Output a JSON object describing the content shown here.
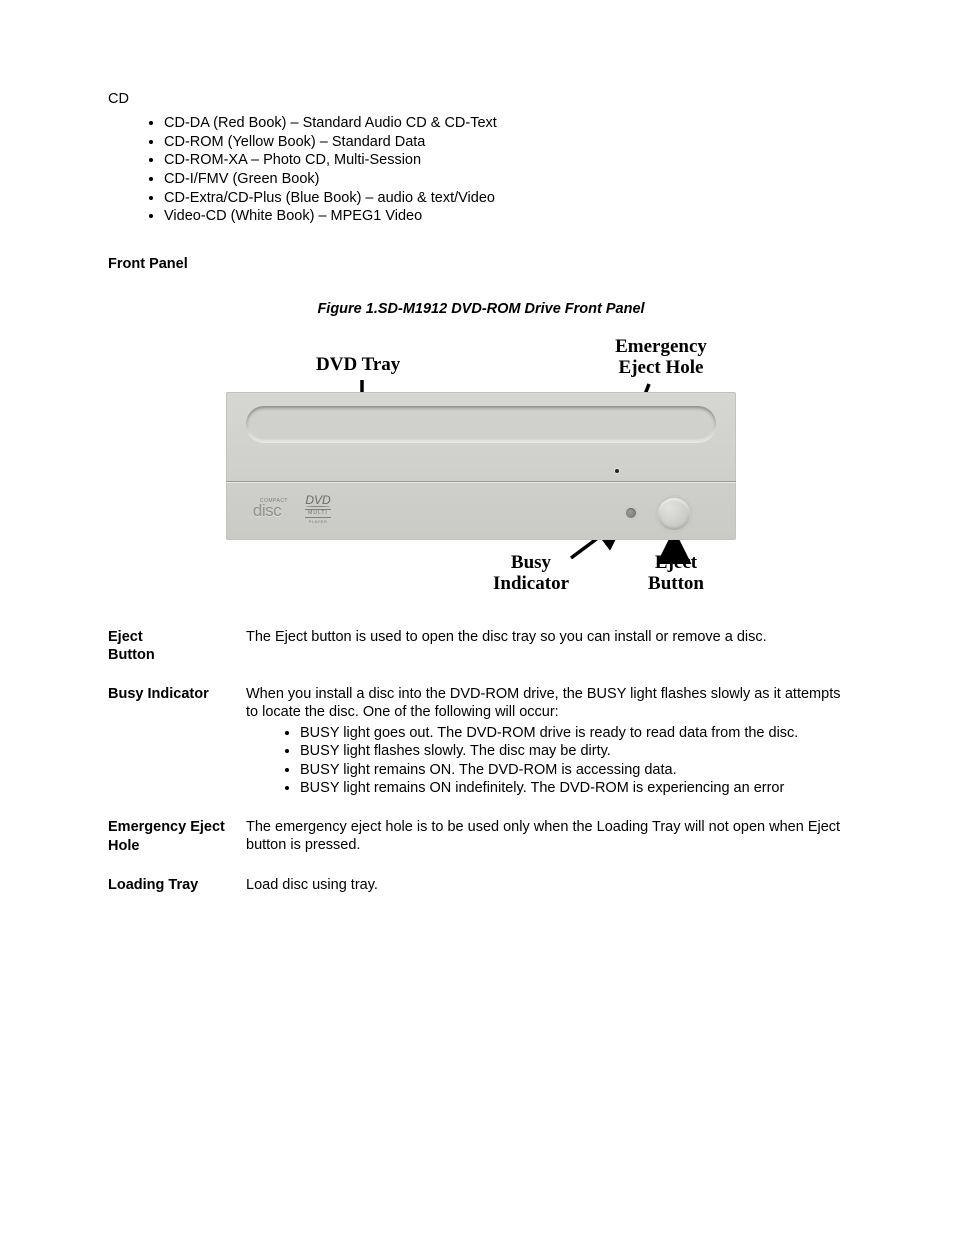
{
  "cd_label": "CD",
  "cd_formats": [
    "CD-DA (Red Book) – Standard Audio CD  & CD-Text",
    "CD-ROM (Yellow Book) – Standard Data",
    "CD-ROM-XA – Photo CD, Multi-Session",
    "CD-I/FMV (Green Book)",
    "CD-Extra/CD-Plus (Blue Book) – audio & text/Video",
    "Video-CD (White Book) – MPEG1 Video"
  ],
  "front_panel_heading": "Front Panel",
  "figure_caption": "Figure 1.SD-M1912 DVD-ROM Drive Front Panel",
  "figure_labels": {
    "dvd_tray": "DVD Tray",
    "emergency_eject_hole": "Emergency\nEject Hole",
    "busy_indicator": "Busy\nIndicator",
    "eject_button": "Eject\nButton"
  },
  "logos": {
    "compact": "COMPACT",
    "disc": "disc",
    "dvd": "DVD",
    "multi": "MULTI",
    "player": "PLAYER"
  },
  "definitions": [
    {
      "term": "Eject\n Button",
      "body": "The Eject button is used to open the disc tray so you can install or remove a disc.",
      "bullets": []
    },
    {
      "term": "Busy Indicator",
      "body": "When you install a disc into the DVD-ROM drive, the BUSY light flashes slowly as it attempts to locate the disc. One of the following will occur:",
      "bullets": [
        "BUSY light goes out. The DVD-ROM drive is ready to read data from the disc.",
        "BUSY light flashes slowly. The disc may be dirty.",
        "BUSY light remains ON. The DVD-ROM is accessing data.",
        "BUSY light remains ON indefinitely. The DVD-ROM is experiencing an error"
      ]
    },
    {
      "term": "Emergency Eject Hole",
      "body": "The emergency eject hole is to be used only when the Loading Tray will not open when Eject button is pressed.",
      "bullets": []
    },
    {
      "term": "Loading Tray",
      "body": "Load disc using tray.",
      "bullets": []
    }
  ]
}
